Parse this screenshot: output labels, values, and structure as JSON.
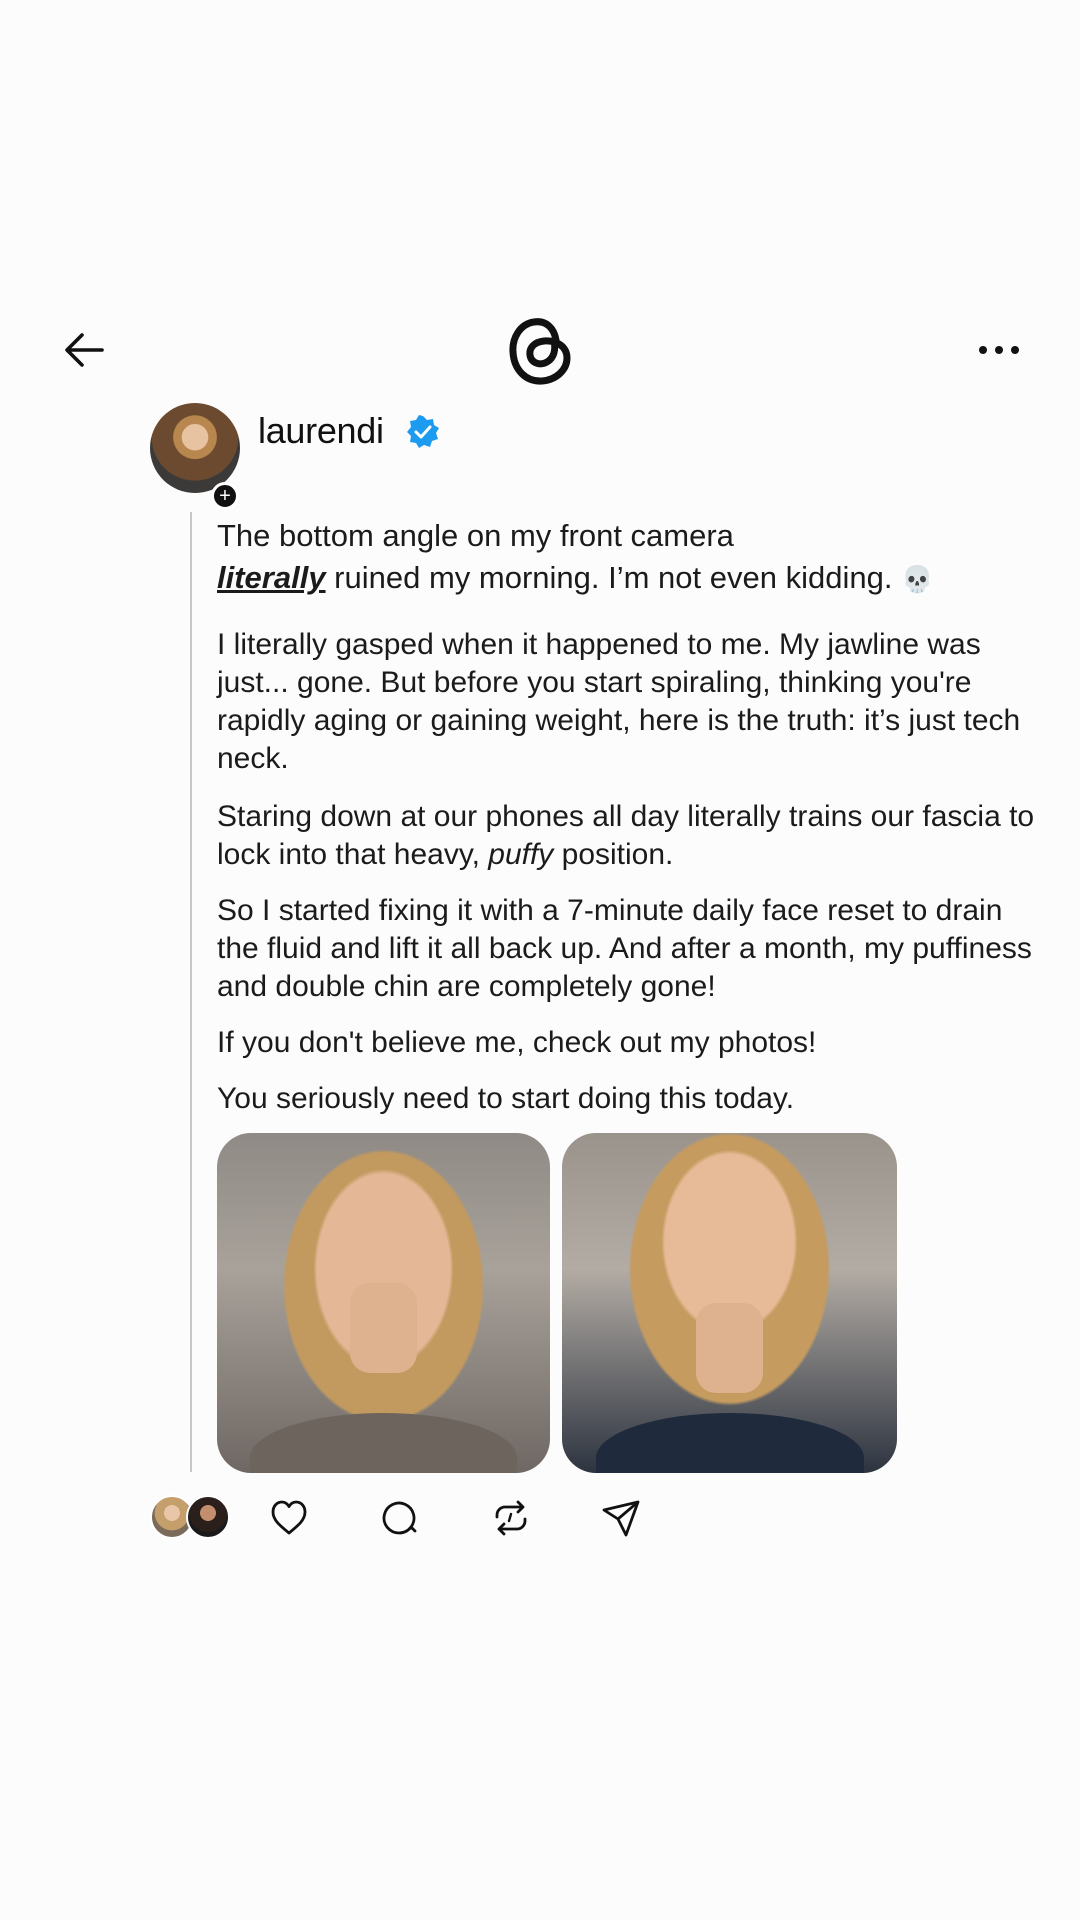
{
  "header": {
    "back_icon": "arrow-left-icon",
    "logo_icon": "threads-logo-icon",
    "more_icon": "more-horizontal-icon"
  },
  "author": {
    "username": "laurendi",
    "verified": true,
    "verified_color": "#1d9bf0",
    "follow_badge": "+"
  },
  "post": {
    "p1_a": "The bottom angle on my front camera",
    "p1_emph": "literally",
    "p1_b": " ruined my morning. I’m not even kidding. ",
    "p1_emoji": "💀",
    "p2": "I literally gasped when it happened to me. My jawline was just... gone. But before you start spiraling, thinking you're rapidly aging or gaining weight, here is the truth: it’s just tech neck.",
    "p3_a": "Staring down at our phones all day literally trains our fascia to lock into that heavy, ",
    "p3_emph": "puffy",
    "p3_b": " position.",
    "p4": "So I started fixing it with a 7-minute daily face reset to drain the fluid and lift it all back up. And after a month, my puffiness and double chin are completely gone!",
    "p5": "If you don't believe me, check out my photos!",
    "p6": "You seriously need to start doing this today."
  },
  "actions": {
    "like_icon": "heart-icon",
    "comment_icon": "comment-icon",
    "repost_icon": "repost-icon",
    "share_icon": "send-icon"
  }
}
